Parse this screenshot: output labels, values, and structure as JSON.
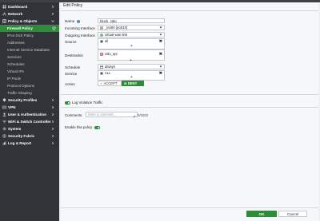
{
  "sidebar": {
    "items": [
      {
        "label": "Dashboard",
        "icon": "dashboard-icon"
      },
      {
        "label": "Network",
        "icon": "network-icon"
      },
      {
        "label": "Policy & Objects",
        "icon": "policy-icon"
      },
      {
        "label": "Firewall Policy"
      },
      {
        "label": "IPv4 DoS Policy"
      },
      {
        "label": "Addresses"
      },
      {
        "label": "Internet Service Database"
      },
      {
        "label": "Services"
      },
      {
        "label": "Schedules"
      },
      {
        "label": "Virtual IPs"
      },
      {
        "label": "IP Pools"
      },
      {
        "label": "Protocol Options"
      },
      {
        "label": "Traffic Shaping"
      },
      {
        "label": "Security Profiles",
        "icon": "security-profiles-icon"
      },
      {
        "label": "VPN",
        "icon": "vpn-icon"
      },
      {
        "label": "User & Authentication",
        "icon": "user-icon"
      },
      {
        "label": "WiFi & Switch Controller",
        "icon": "wifi-icon"
      },
      {
        "label": "System",
        "icon": "system-icon"
      },
      {
        "label": "Security Fabric",
        "icon": "security-fabric-icon"
      },
      {
        "label": "Log & Report",
        "icon": "log-icon"
      }
    ]
  },
  "panel": {
    "title": "Edit Policy"
  },
  "form": {
    "name_label": "Name",
    "name_value": "block_zalo",
    "incoming_label": "Incoming Interface",
    "incoming_value": "_lan60 (port10)",
    "outgoing_label": "Outgoing Interface",
    "outgoing_value": "virtual-wan-link",
    "source_label": "Source",
    "source_value": "all",
    "destination_label": "Destination",
    "destination_value": "zalo_api",
    "schedule_label": "Schedule",
    "schedule_value": "always",
    "service_label": "Service",
    "service_value": "ALL",
    "action_label": "Action",
    "accept_label": "ACCEPT",
    "deny_label": "DENY",
    "log_label": "Log Violation Traffic",
    "comments_label": "Comments",
    "comments_placeholder": "Write a comment...",
    "comments_counter": "0/1023",
    "enable_label": "Enable this policy"
  },
  "footer": {
    "ok_label": "OK",
    "cancel_label": "Cancel"
  },
  "colors": {
    "accent": "#2e8b3a",
    "sidebar_bg": "#303337",
    "panel_bg": "#f6f7f8"
  }
}
